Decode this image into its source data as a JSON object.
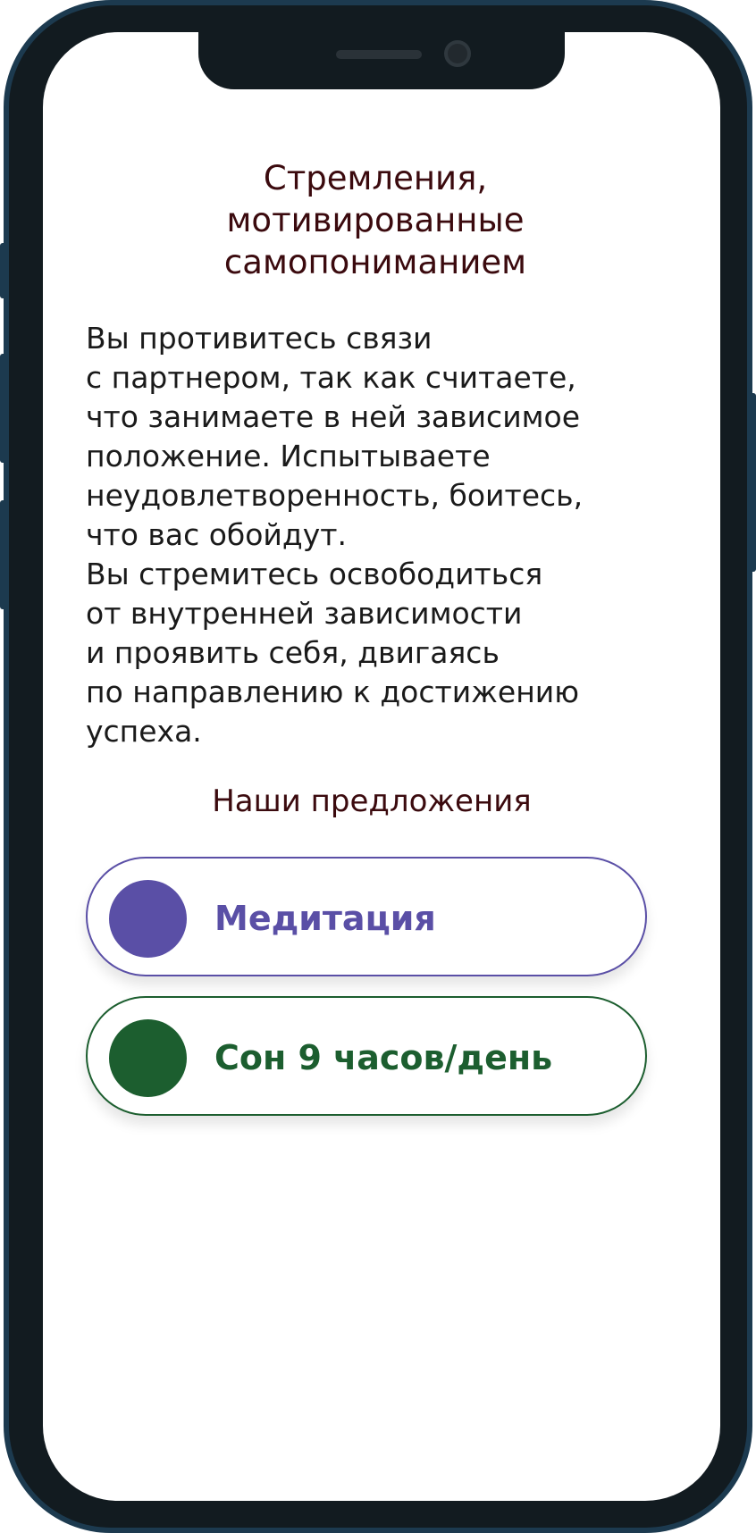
{
  "screen": {
    "title_lines": [
      "Стремления,",
      "мотивированные",
      "самопониманием"
    ],
    "body_lines": [
      "Вы противитесь связи",
      "с партнером, так как считаете,",
      "что занимаете в ней зависимое",
      "положение. Испытываете",
      "неудовлетворенность, боитесь,",
      "что вас обойдут.",
      "Вы стремитесь освободиться",
      "от внутренней зависимости",
      "и проявить себя, двигаясь",
      "по направлению к достижению",
      "успеха."
    ],
    "offers_title": "Наши предложения",
    "offers": [
      {
        "label": "Медитация",
        "color": "#5a4fa6"
      },
      {
        "label": "Сон 9 часов/день",
        "color": "#1c5e2f"
      }
    ]
  },
  "colors": {
    "heading": "#3b0a0e",
    "text": "#1a1a1a",
    "frame": "#121b20",
    "frame_edge": "#1c3a4f"
  }
}
